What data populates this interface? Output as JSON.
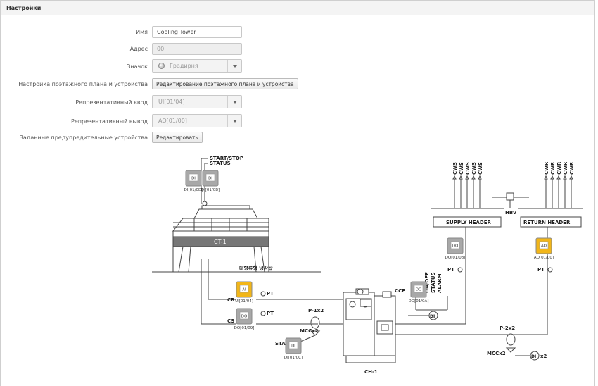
{
  "panel": {
    "title": "Настройки"
  },
  "form": {
    "name": {
      "label": "Имя",
      "value": "Cooling Tower"
    },
    "address": {
      "label": "Адрес",
      "value": "00"
    },
    "icon": {
      "label": "Значок",
      "value": "Градирня"
    },
    "floor_plan": {
      "label": "Настройка поэтажного плана и устройства",
      "button": "Редактирование поэтажного плана и устройства"
    },
    "rep_input": {
      "label": "Репрезентативный ввод",
      "value": "UI[01/04]"
    },
    "rep_output": {
      "label": "Репрезентативный вывод",
      "value": "AO[01/00]"
    },
    "warning_devices": {
      "label": "Заданные предупредительные устройства",
      "button": "Редактировать"
    }
  },
  "diagram": {
    "start_stop": "START/STOP",
    "status": "STATUS",
    "status2": "STATUS",
    "ct1": "CT-1",
    "korean": "대향류형 냉각탑",
    "ch1": "CH-1",
    "supply_header": "SUPPLY HEADER",
    "return_header": "RETURN HEADER",
    "hbv": "HBV",
    "ccp": "CCP",
    "cr": "CR",
    "cs": "CS",
    "p1": "P-1x2",
    "p2": "P-2x2",
    "mcc1": "MCCx2",
    "mcc2": "MCCx2",
    "pt": "PT",
    "onoff": "ON/OFF",
    "status_v": "STATUS",
    "alarm": "ALARM",
    "di_x2": "x2",
    "di_sym": "DI",
    "cws": "CWS",
    "cwr": "CWR",
    "devices": {
      "di1": {
        "type": "DI",
        "label": "DI[01/0D]"
      },
      "di2": {
        "type": "DI",
        "label": "DI[01/0B]"
      },
      "ai1": {
        "type": "AI",
        "label": "UI[01/04]"
      },
      "do1": {
        "type": "DO",
        "label": "DO[01/09]"
      },
      "di3": {
        "type": "DI",
        "label": "DI[01/0C]"
      },
      "do2": {
        "type": "DO",
        "label": "DO[01/0A]"
      },
      "do3": {
        "type": "DO",
        "label": "DO[01/08]"
      },
      "ao1": {
        "type": "AO",
        "label": "AO[01/00]"
      }
    },
    "colors": {
      "device_gray": "#a8a8a8",
      "device_active": "#f2b619",
      "line": "#444444"
    }
  }
}
